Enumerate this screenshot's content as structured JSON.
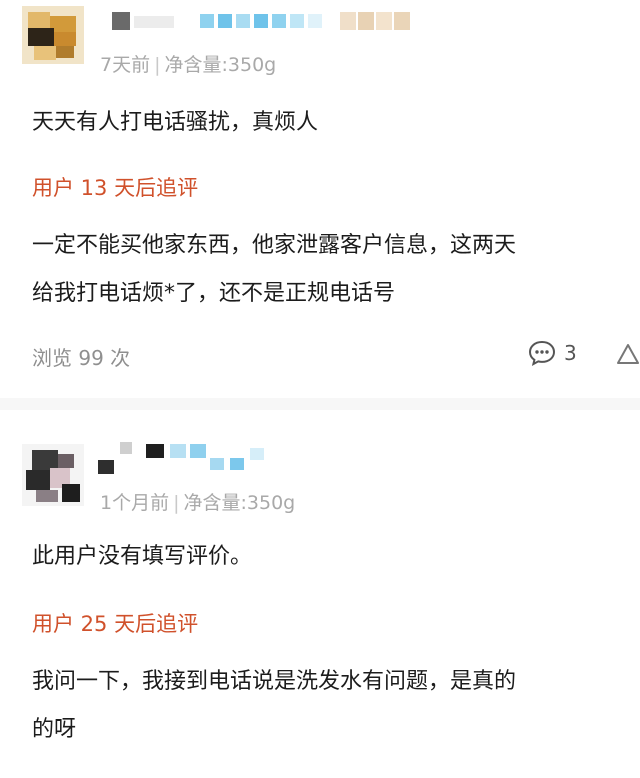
{
  "reviews": [
    {
      "meta_time": "7天前",
      "meta_sep": "|",
      "meta_spec": "净含量:350g",
      "content": "天天有人打电话骚扰，真烦人",
      "followup_label": "用户 13 天后追评",
      "followup_lines": [
        "一定不能买他家东西，他家泄露客户信息，这两天",
        "给我打电话烦*了，还不是正规电话号"
      ],
      "views": "浏览 99 次",
      "comment_count": "3"
    },
    {
      "meta_time": "1个月前",
      "meta_sep": "|",
      "meta_spec": "净含量:350g",
      "content": "此用户没有填写评价。",
      "followup_label": "用户 25 天后追评",
      "followup_lines": [
        "我问一下，我接到电话说是洗发水有问题，是真的",
        "的呀"
      ]
    }
  ],
  "colors": {
    "accent": "#d0512b",
    "meta": "#a9a9a9",
    "body_text": "#1c1c1c"
  },
  "icons": [
    "comment-icon",
    "thumbs-up-icon"
  ]
}
